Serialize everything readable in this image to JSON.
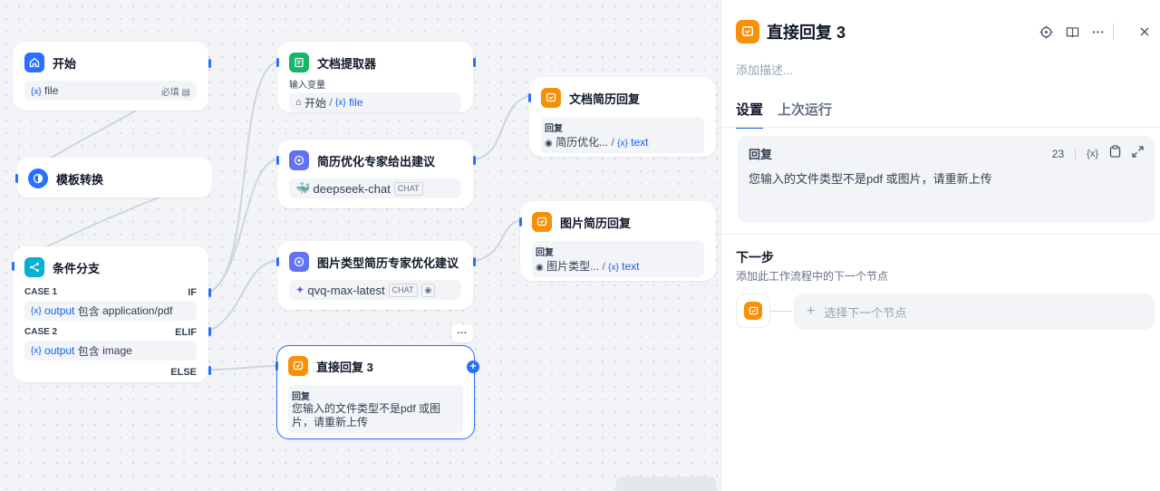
{
  "canvas": {
    "start": {
      "title": "开始",
      "var_label": "file",
      "required": "必填"
    },
    "template": {
      "title": "模板转换"
    },
    "condition": {
      "title": "条件分支",
      "case1_label": "CASE 1",
      "case1_branch": "IF",
      "case1_var": "output",
      "case1_op": "包含",
      "case1_value": "application/pdf",
      "case2_label": "CASE 2",
      "case2_branch": "ELIF",
      "case2_var": "output",
      "case2_op": "包含",
      "case2_value": "image",
      "else_branch": "ELSE"
    },
    "doc_extractor": {
      "title": "文档提取器",
      "input_label": "输入变量",
      "source": "开始",
      "sep": "/",
      "var": "file"
    },
    "resume_advice": {
      "title": "简历优化专家给出建议",
      "model": "deepseek-chat",
      "tag": "CHAT"
    },
    "image_advice": {
      "title": "图片类型简历专家优化建议",
      "model": "qvq-max-latest",
      "tag": "CHAT"
    },
    "direct_reply": {
      "title": "直接回复 3",
      "label": "回复",
      "text": "您输入的文件类型不是pdf 或图片，请重新上传"
    },
    "doc_reply": {
      "title": "文档简历回复",
      "label": "回复",
      "source": "简历优化...",
      "sep": "/",
      "var": "text"
    },
    "img_reply": {
      "title": "图片简历回复",
      "label": "回复",
      "source": "图片类型...",
      "sep": "/",
      "var": "text"
    },
    "more_btn": "···",
    "var_icon": "{x}"
  },
  "panel": {
    "title": "直接回复 3",
    "desc_placeholder": "添加描述...",
    "tabs": [
      "设置",
      "上次运行"
    ],
    "reply_label": "回复",
    "char_count": "23",
    "var_icon": "{x}",
    "reply_text": "您输入的文件类型不是pdf 或图片，请重新上传",
    "next_title": "下一步",
    "next_desc": "添加此工作流程中的下一个节点",
    "next_select": "选择下一个节点",
    "next_plus": "+"
  },
  "colors": {
    "accent": "#2970ff",
    "orange": "#f79009",
    "green": "#12b76a",
    "indigo": "#6172f3",
    "cyan": "#06aed4"
  },
  "icons": [
    "home-icon",
    "template-icon",
    "branch-icon",
    "doc-icon",
    "llm-icon",
    "reply-icon",
    "locate-icon",
    "book-icon",
    "more-icon",
    "close-icon",
    "clipboard-icon",
    "expand-icon"
  ]
}
